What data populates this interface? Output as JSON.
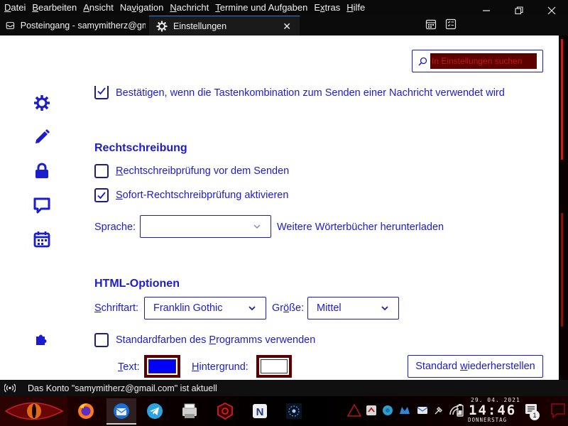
{
  "menubar": {
    "items": [
      {
        "pre": "",
        "acc": "D",
        "post": "atei"
      },
      {
        "pre": "",
        "acc": "B",
        "post": "earbeiten"
      },
      {
        "pre": "",
        "acc": "A",
        "post": "nsicht"
      },
      {
        "pre": "Na",
        "acc": "v",
        "post": "igation"
      },
      {
        "pre": "",
        "acc": "N",
        "post": "achricht"
      },
      {
        "pre": "",
        "acc": "T",
        "post": "ermine und Aufgaben"
      },
      {
        "pre": "E",
        "acc": "x",
        "post": "tras"
      },
      {
        "pre": "",
        "acc": "H",
        "post": "ilfe"
      }
    ]
  },
  "window_controls": {
    "minimize": "minimize-icon",
    "maximize": "restore-icon",
    "close": "close-icon"
  },
  "tabs": [
    {
      "label": "Posteingang - samymitherz@gmail.com",
      "icon": "inbox-icon"
    },
    {
      "label": "Einstellungen",
      "icon": "gear-icon",
      "close": "✕"
    }
  ],
  "sidebar": {
    "icons": [
      "gear-icon",
      "pencil-icon",
      "lock-icon",
      "chat-icon",
      "calendar-icon",
      "puzzle-icon"
    ]
  },
  "search": {
    "placeholder": "In Einstellungen suchen"
  },
  "settings": {
    "partial_checkbox_label": "Bestätigen, wenn die Tastenkombination zum Senden einer Nachricht verwendet wird",
    "spelling": {
      "heading": "Rechtschreibung",
      "check_before_send": {
        "pre": "",
        "acc": "R",
        "post": "echtschreibprüfung vor dem Senden",
        "checked": false
      },
      "instant_check": {
        "pre": "",
        "acc": "S",
        "post": "ofort-Rechtschreibprüfung aktivieren",
        "checked": true
      },
      "language_label": "Sprache:",
      "language_value": "",
      "more_dictionaries": "Weitere Wörterbücher herunterladen"
    },
    "html": {
      "heading": "HTML-Optionen",
      "font_label_acc": "S",
      "font_label_post": "chriftart:",
      "font_value": "Franklin Gothic",
      "size_label_pre": "Gr",
      "size_label_acc": "ö",
      "size_label_post": "ße:",
      "size_value": "Mittel",
      "default_colors": {
        "pre": "Standardfarben des ",
        "acc": "P",
        "post": "rogramms verwenden",
        "checked": false
      },
      "text_label_pre": "",
      "text_label_acc": "T",
      "text_label_post": "ext:",
      "text_color": "#0000ff",
      "background_label_acc": "H",
      "background_label_post": "intergrund:",
      "background_color": "#ffffff",
      "restore_pre": "Standard ",
      "restore_acc": "w",
      "restore_post": "iederherstellen"
    }
  },
  "statusbar": {
    "text": "Das Konto \"samymitherz@gmail.com\" ist aktuell",
    "icon": "broadcast-icon"
  },
  "taskbar": {
    "apps": [
      "dragon-eye-icon",
      "firefox-icon",
      "thunderbird-icon",
      "telegram-icon",
      "scanner-icon",
      "vpn-shield-icon",
      "netbeans-icon",
      "galaxy-icon"
    ],
    "tray_icons": [
      "warning-triangle-icon",
      "sync-icon",
      "edge-icon",
      "malwarebytes-icon",
      "mail-tray-icon",
      "usb-icon",
      "wifi-icon",
      "battery-icon",
      "notes-icon"
    ],
    "date": "29. 04. 2021",
    "time": "14:46",
    "weekday": "DONNERSTAG",
    "notification_count": "1"
  },
  "colors": {
    "accent": "#1c1ccf",
    "dark_red": "#5a0000",
    "tab_accent": "#3a7bd5"
  }
}
